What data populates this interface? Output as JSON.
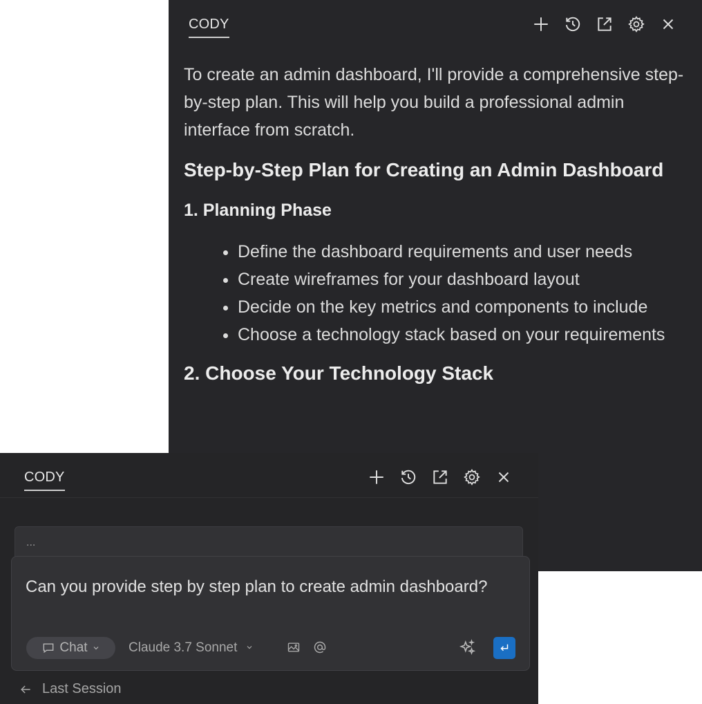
{
  "back_panel": {
    "tab_label": "CODY",
    "header_icons": [
      "plus-icon",
      "history-icon",
      "open-external-icon",
      "gear-icon",
      "close-icon"
    ],
    "intro": "To create an admin dashboard, I'll provide a comprehensive step-by-step plan. This will help you build a professional admin interface from scratch.",
    "heading": "Step-by-Step Plan for Creating an Admin Dashboard",
    "subheading": "1. Planning Phase",
    "bullets": [
      "Define the dashboard requirements and user needs",
      "Create wireframes for your dashboard layout",
      "Decide on the key metrics and components to include",
      "Choose a technology stack based on your requirements"
    ],
    "next_heading_cut": "2. Choose Your Technology Stack"
  },
  "front_panel": {
    "tab_label": "CODY",
    "previous_message": "...",
    "input_text": "Can you provide step by step plan to create admin dashboard?",
    "mode_label": "Chat",
    "model_label": "Claude 3.7 Sonnet",
    "footer_label": "Last Session",
    "accent_color": "#1a6fc4"
  }
}
